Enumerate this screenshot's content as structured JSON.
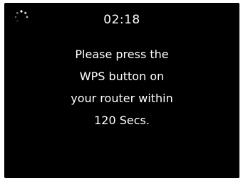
{
  "timer": {
    "value": "02:18"
  },
  "spinner": {
    "icon": "loading-spinner-icon"
  },
  "message": {
    "lines": [
      "Please press the",
      "WPS button on",
      "your router within",
      "120 Secs."
    ]
  },
  "colors": {
    "background": "#000000",
    "text": "#ffffff"
  }
}
